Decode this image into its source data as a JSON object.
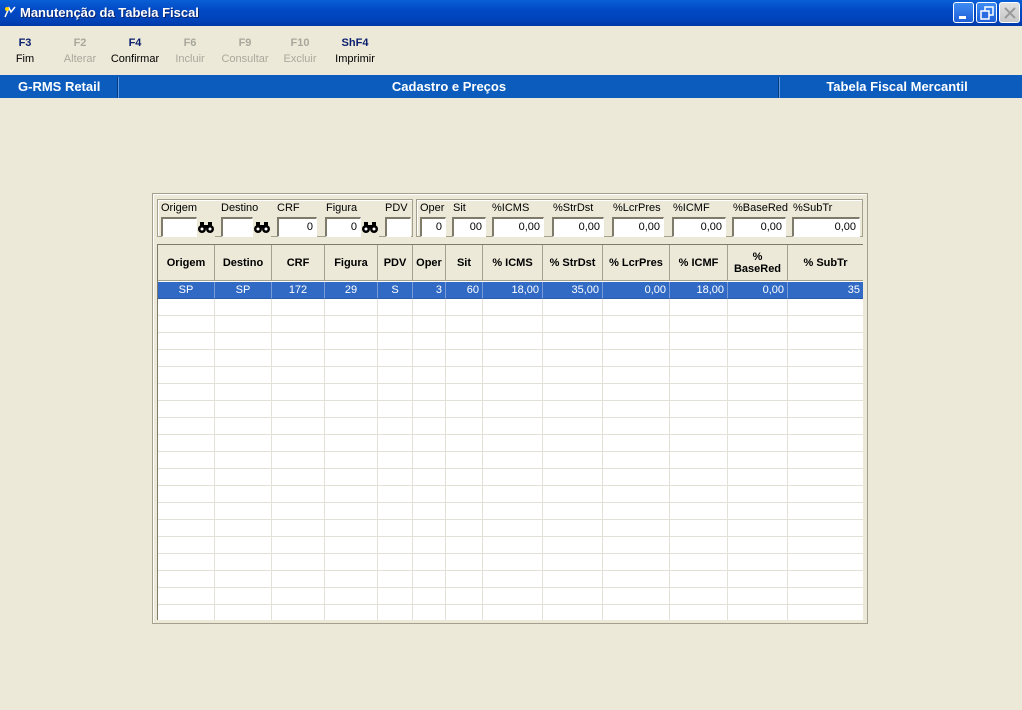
{
  "window": {
    "title": "Manutenção da Tabela Fiscal",
    "minimize_icon": "minimize-icon",
    "restore_icon": "restore-icon",
    "close_icon": "close-icon"
  },
  "toolbar": {
    "items": [
      {
        "key": "F3",
        "label": "Fim",
        "enabled": true
      },
      {
        "key": "F2",
        "label": "Alterar",
        "enabled": false
      },
      {
        "key": "F4",
        "label": "Confirmar",
        "enabled": true
      },
      {
        "key": "F6",
        "label": "Incluir",
        "enabled": false
      },
      {
        "key": "F9",
        "label": "Consultar",
        "enabled": false
      },
      {
        "key": "F10",
        "label": "Excluir",
        "enabled": false
      },
      {
        "key": "ShF4",
        "label": "Imprimir",
        "enabled": true
      }
    ]
  },
  "header": {
    "left": "G-RMS Retail",
    "center": "Cadastro e Preços",
    "right": "Tabela Fiscal Mercantil"
  },
  "filters": {
    "origem": {
      "label": "Origem",
      "value": ""
    },
    "destino": {
      "label": "Destino",
      "value": ""
    },
    "crf": {
      "label": "CRF",
      "value": "0"
    },
    "figura": {
      "label": "Figura",
      "value": "0"
    },
    "pdv": {
      "label": "PDV",
      "value": ""
    },
    "oper": {
      "label": "Oper",
      "value": "0"
    },
    "sit": {
      "label": "Sit",
      "value": "00"
    },
    "icms": {
      "label": "%ICMS",
      "value": "0,00"
    },
    "strdst": {
      "label": "%StrDst",
      "value": "0,00"
    },
    "lcrpres": {
      "label": "%LcrPres",
      "value": "0,00"
    },
    "icmf": {
      "label": "%ICMF",
      "value": "0,00"
    },
    "basered": {
      "label": "%BaseRed",
      "value": "0,00"
    },
    "subtr": {
      "label": "%SubTr",
      "value": "0,00"
    }
  },
  "grid": {
    "columns": [
      "Origem",
      "Destino",
      "CRF",
      "Figura",
      "PDV",
      "Oper",
      "Sit",
      "% ICMS",
      "% StrDst",
      "% LcrPres",
      "% ICMF",
      "%\nBaseRed",
      "% SubTr"
    ],
    "rows": [
      [
        "SP",
        "SP",
        "172",
        "29",
        "S",
        "3",
        "60",
        "18,00",
        "35,00",
        "0,00",
        "18,00",
        "0,00",
        "35"
      ]
    ],
    "selected_row": 0
  },
  "colors": {
    "titlebar": "#0049c4",
    "header": "#0b5cbc",
    "selection": "#316ac5",
    "background": "#ece9d8"
  }
}
